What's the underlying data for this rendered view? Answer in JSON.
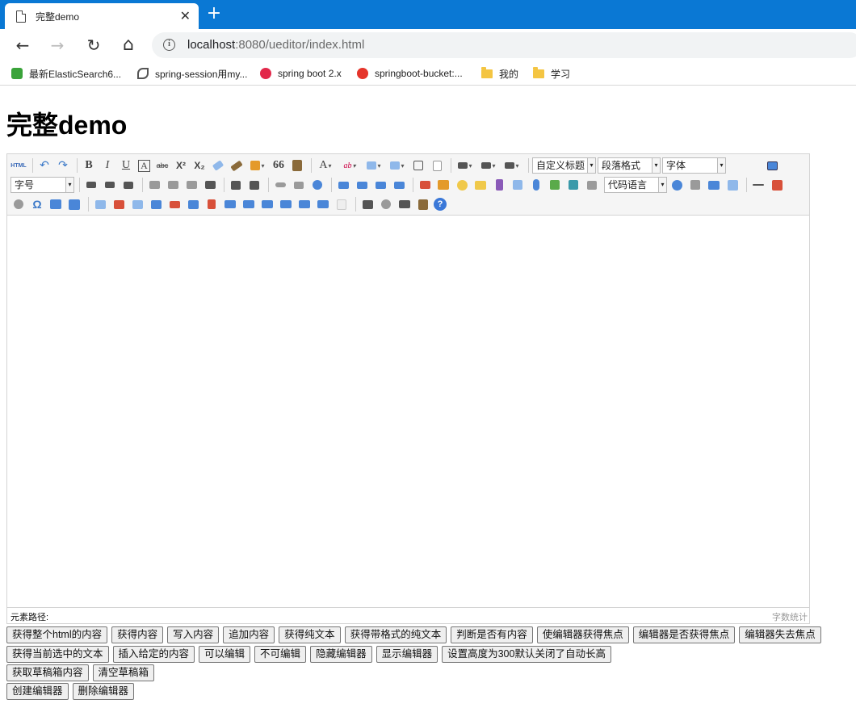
{
  "browser": {
    "tab_title": "完整demo",
    "tab_close": "✕",
    "new_tab": "+",
    "back": "←",
    "forward": "→",
    "reload": "↻",
    "home": "⌂",
    "url_host": "localhost",
    "url_path": ":8080/ueditor/index.html",
    "info_icon": "i"
  },
  "bookmarks": [
    {
      "label": "最新ElasticSearch6...",
      "icon": "green"
    },
    {
      "label": "spring-session用my...",
      "icon": "spring"
    },
    {
      "label": "spring boot 2.x",
      "icon": "red"
    },
    {
      "label": "springboot-bucket:...",
      "icon": "red2"
    },
    {
      "label": "我的",
      "icon": "folder"
    },
    {
      "label": "学习",
      "icon": "folder"
    }
  ],
  "page": {
    "title": "完整demo"
  },
  "toolbar": {
    "html_label": "HTML",
    "bold": "B",
    "italic": "I",
    "underline": "U",
    "font_border": "A",
    "strikethrough": "abc",
    "superscript": "X²",
    "subscript": "X₂",
    "blockquote": "66",
    "forecolor": "A",
    "backcolor": "ab",
    "custom_title": "自定义标题",
    "paragraph": "段落格式",
    "font_family": "字体",
    "font_size": "字号",
    "code_lang": "代码语言",
    "omega": "Ω",
    "help": "?"
  },
  "status": {
    "element_path": "元素路径:",
    "word_count": "字数统计"
  },
  "buttons": {
    "row1": [
      "获得整个html的内容",
      "获得内容",
      "写入内容",
      "追加内容",
      "获得纯文本",
      "获得带格式的纯文本",
      "判断是否有内容",
      "使编辑器获得焦点",
      "编辑器是否获得焦点",
      "编辑器失去焦点"
    ],
    "row2": [
      "获得当前选中的文本",
      "插入给定的内容",
      "可以编辑",
      "不可编辑",
      "隐藏编辑器",
      "显示编辑器",
      "设置高度为300默认关闭了自动长高"
    ],
    "row3": [
      "获取草稿箱内容",
      "清空草稿箱"
    ],
    "row4": [
      "创建编辑器",
      "删除编辑器"
    ]
  }
}
